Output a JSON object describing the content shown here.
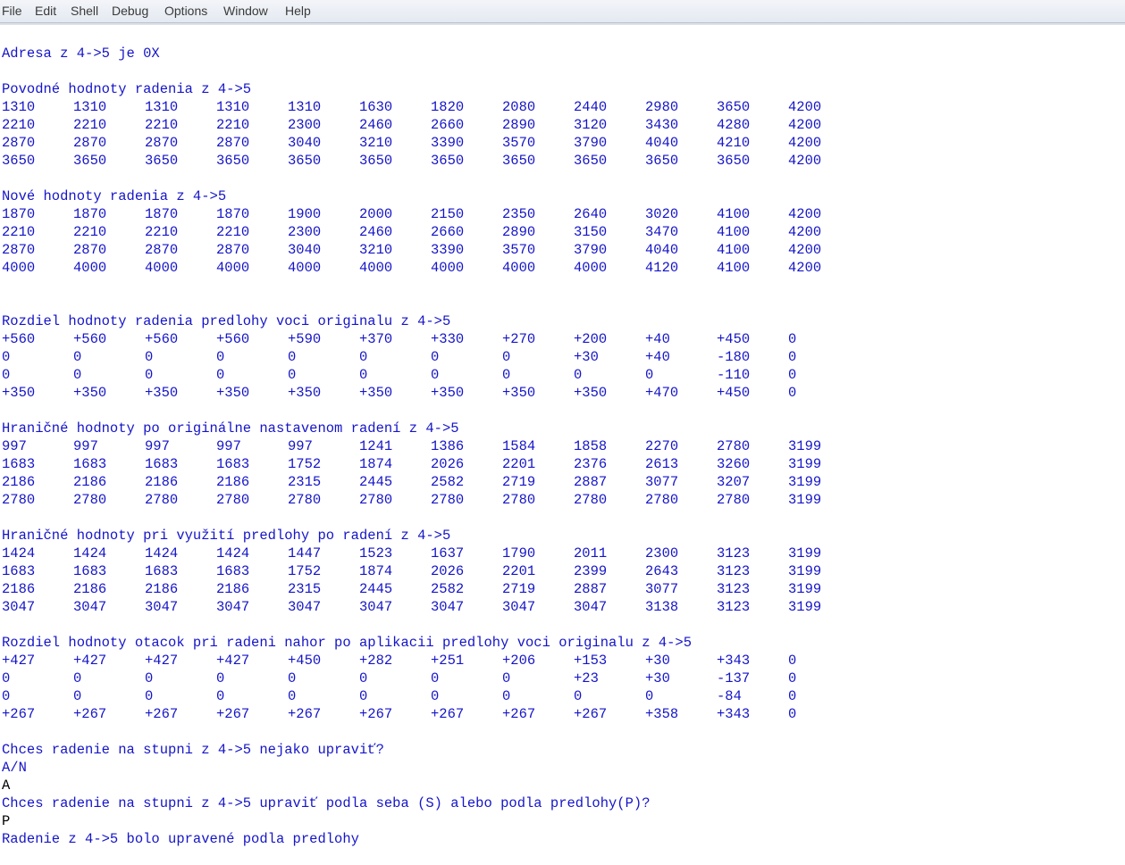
{
  "menu": [
    "File",
    "Edit",
    "Shell",
    "Debug",
    "Options",
    "Window",
    "Help"
  ],
  "colors": {
    "output": "#1515c8",
    "input": "#000000",
    "menubar": "#e4e9f1"
  },
  "shell": {
    "address_line": "Adresa z 4->5 je 0X",
    "sections": [
      {
        "title": "Povodné hodnoty radenia z 4->5",
        "rows": [
          [
            "1310",
            "1310",
            "1310",
            "1310",
            "1310",
            "1630",
            "1820",
            "2080",
            "2440",
            "2980",
            "3650",
            "4200"
          ],
          [
            "2210",
            "2210",
            "2210",
            "2210",
            "2300",
            "2460",
            "2660",
            "2890",
            "3120",
            "3430",
            "4280",
            "4200"
          ],
          [
            "2870",
            "2870",
            "2870",
            "2870",
            "3040",
            "3210",
            "3390",
            "3570",
            "3790",
            "4040",
            "4210",
            "4200"
          ],
          [
            "3650",
            "3650",
            "3650",
            "3650",
            "3650",
            "3650",
            "3650",
            "3650",
            "3650",
            "3650",
            "3650",
            "4200"
          ]
        ]
      },
      {
        "title": "Nové hodnoty radenia z 4->5",
        "rows": [
          [
            "1870",
            "1870",
            "1870",
            "1870",
            "1900",
            "2000",
            "2150",
            "2350",
            "2640",
            "3020",
            "4100",
            "4200"
          ],
          [
            "2210",
            "2210",
            "2210",
            "2210",
            "2300",
            "2460",
            "2660",
            "2890",
            "3150",
            "3470",
            "4100",
            "4200"
          ],
          [
            "2870",
            "2870",
            "2870",
            "2870",
            "3040",
            "3210",
            "3390",
            "3570",
            "3790",
            "4040",
            "4100",
            "4200"
          ],
          [
            "4000",
            "4000",
            "4000",
            "4000",
            "4000",
            "4000",
            "4000",
            "4000",
            "4000",
            "4120",
            "4100",
            "4200"
          ]
        ]
      },
      {
        "title": "Rozdiel hodnoty radenia predlohy voci originalu z 4->5",
        "rows": [
          [
            "+560",
            "+560",
            "+560",
            "+560",
            "+590",
            "+370",
            "+330",
            "+270",
            "+200",
            "+40",
            "+450",
            "0"
          ],
          [
            "0",
            "0",
            "0",
            "0",
            "0",
            "0",
            "0",
            "0",
            "+30",
            "+40",
            "-180",
            "0"
          ],
          [
            "0",
            "0",
            "0",
            "0",
            "0",
            "0",
            "0",
            "0",
            "0",
            "0",
            "-110",
            "0"
          ],
          [
            "+350",
            "+350",
            "+350",
            "+350",
            "+350",
            "+350",
            "+350",
            "+350",
            "+350",
            "+470",
            "+450",
            "0"
          ]
        ]
      },
      {
        "title": "Hraničné hodnoty po originálne nastavenom radení z 4->5",
        "rows": [
          [
            "997",
            "997",
            "997",
            "997",
            "997",
            "1241",
            "1386",
            "1584",
            "1858",
            "2270",
            "2780",
            "3199"
          ],
          [
            "1683",
            "1683",
            "1683",
            "1683",
            "1752",
            "1874",
            "2026",
            "2201",
            "2376",
            "2613",
            "3260",
            "3199"
          ],
          [
            "2186",
            "2186",
            "2186",
            "2186",
            "2315",
            "2445",
            "2582",
            "2719",
            "2887",
            "3077",
            "3207",
            "3199"
          ],
          [
            "2780",
            "2780",
            "2780",
            "2780",
            "2780",
            "2780",
            "2780",
            "2780",
            "2780",
            "2780",
            "2780",
            "3199"
          ]
        ]
      },
      {
        "title": "Hraničné hodnoty pri využití predlohy po radení z 4->5",
        "rows": [
          [
            "1424",
            "1424",
            "1424",
            "1424",
            "1447",
            "1523",
            "1637",
            "1790",
            "2011",
            "2300",
            "3123",
            "3199"
          ],
          [
            "1683",
            "1683",
            "1683",
            "1683",
            "1752",
            "1874",
            "2026",
            "2201",
            "2399",
            "2643",
            "3123",
            "3199"
          ],
          [
            "2186",
            "2186",
            "2186",
            "2186",
            "2315",
            "2445",
            "2582",
            "2719",
            "2887",
            "3077",
            "3123",
            "3199"
          ],
          [
            "3047",
            "3047",
            "3047",
            "3047",
            "3047",
            "3047",
            "3047",
            "3047",
            "3047",
            "3138",
            "3123",
            "3199"
          ]
        ]
      },
      {
        "title": "Rozdiel hodnoty otacok pri radeni nahor po aplikacii predlohy voci originalu z 4->5",
        "rows": [
          [
            "+427",
            "+427",
            "+427",
            "+427",
            "+450",
            "+282",
            "+251",
            "+206",
            "+153",
            "+30",
            "+343",
            "0"
          ],
          [
            "0",
            "0",
            "0",
            "0",
            "0",
            "0",
            "0",
            "0",
            "+23",
            "+30",
            "-137",
            "0"
          ],
          [
            "0",
            "0",
            "0",
            "0",
            "0",
            "0",
            "0",
            "0",
            "0",
            "0",
            "-84",
            "0"
          ],
          [
            "+267",
            "+267",
            "+267",
            "+267",
            "+267",
            "+267",
            "+267",
            "+267",
            "+267",
            "+358",
            "+343",
            "0"
          ]
        ]
      }
    ],
    "prompt1": "Chces radenie na stupni z 4->5 nejako upraviť?",
    "options1": "A/N",
    "input1": "A",
    "prompt2": "Chces radenie na stupni z 4->5 upraviť podla seba (S) alebo podla predlohy(P)?",
    "input2": "P",
    "result": "Radenie z 4->5 bolo upravené podla predlohy"
  }
}
